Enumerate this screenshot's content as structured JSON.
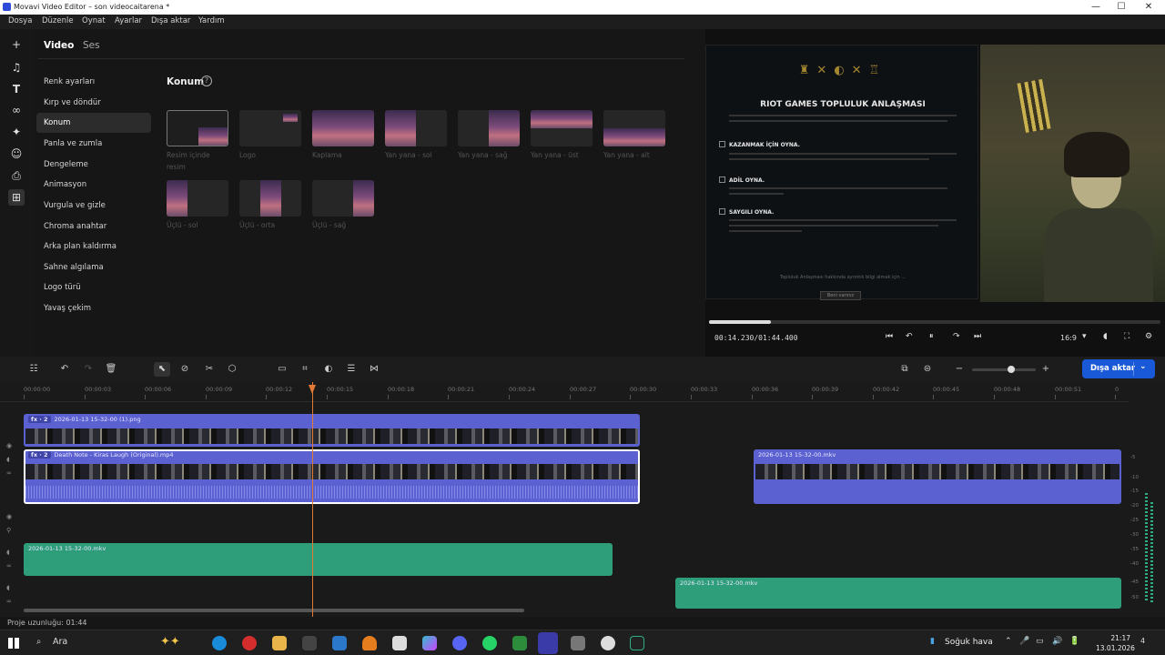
{
  "window": {
    "title": "Movavi Video Editor – son videocaitarena *",
    "controls": [
      "—",
      "☐",
      "✕"
    ]
  },
  "menu": [
    "Dosya",
    "Düzenle",
    "Oynat",
    "Ayarlar",
    "Dışa aktar",
    "Yardım"
  ],
  "sidebar_icons": [
    "plus-icon",
    "music-note-icon",
    "text-t-icon",
    "transition-icon",
    "sparkle-icon",
    "sticker-icon",
    "camera-icon",
    "tools-grid-icon"
  ],
  "panel": {
    "tabs": [
      "Video",
      "Ses"
    ],
    "menu_items": [
      "Renk ayarları",
      "Kırp ve döndür",
      "Konum",
      "Panla ve zumla",
      "Dengeleme",
      "Animasyon",
      "Vurgula ve gizle",
      "Chroma anahtar",
      "Arka plan kaldırma",
      "Sahne algılama",
      "Logo türü",
      "Yavaş çekim"
    ],
    "selected_item": "Konum",
    "section_title": "Konum",
    "tiles": [
      {
        "label": "Resim içinde resim"
      },
      {
        "label": "Logo"
      },
      {
        "label": "Kaplama"
      },
      {
        "label": "Yan yana - sol"
      },
      {
        "label": "Yan yana - sağ"
      },
      {
        "label": "Yan yana - üst"
      },
      {
        "label": "Yan yana - alt"
      },
      {
        "label": "Üçlü - sol"
      },
      {
        "label": "Üçlü - orta"
      },
      {
        "label": "Üçlü - sağ"
      }
    ]
  },
  "preview": {
    "game_overlay": {
      "heading": "RIOT GAMES TOPLULUK ANLAŞMASI",
      "rules": [
        "KAZANMAK İÇİN OYNA.",
        "ADİL OYNA.",
        "SAYGILI OYNA."
      ],
      "footer": "Topluluk Anlaşması hakkında ayrıntılı bilgi almak için ...",
      "button": "Beni varınız"
    },
    "timecode": "00:14.230/01:44.400",
    "progress_fraction": 0.1363,
    "aspect": "16:9",
    "controls": {
      "prev": "⏮",
      "back": "↶",
      "pause": "⏸",
      "fwd": "↷",
      "next": "⏭",
      "aspect_caret": "▾",
      "volume": "◖",
      "fullscreen": "⛶",
      "settings": "⚙"
    }
  },
  "toolbar": {
    "export_label": "Dışa aktar",
    "export_caret": "⌄",
    "icons": {
      "settings": "☷",
      "undo": "↶",
      "redo": "↷",
      "trash": "🗑",
      "select": "⬉",
      "razor_tool": "⊘",
      "scissors": "✂",
      "marker": "⬡",
      "caption": "▭",
      "crop": "⌗",
      "color": "◐",
      "adjust": "☰",
      "transition": "⋈",
      "detach": "⧉",
      "record": "⊜",
      "zoom_out": "−",
      "zoom_in": "+"
    },
    "zoom_level": 0.62
  },
  "ruler_ticks": [
    "00:00:00",
    "00:00:03",
    "00:00:06",
    "00:00:09",
    "00:00:12",
    "00:00:15",
    "00:00:18",
    "00:00:21",
    "00:00:24",
    "00:00:27",
    "00:00:30",
    "00:00:33",
    "00:00:36",
    "00:00:39",
    "00:00:42",
    "00:00:45",
    "00:00:48",
    "00:00:51",
    "0"
  ],
  "clips": {
    "overlay_image": {
      "fx": "fx · 2",
      "name": "2026-01-13 15-32-00 (1).png"
    },
    "main_video": {
      "fx": "fx · 2",
      "name": "Death Note - Kiras Laugh (Original).mp4"
    },
    "right_video": {
      "name": "2026-01-13 15-32-00.mkv"
    },
    "audio1": {
      "name": "2026-01-13 15-32-00.mkv"
    },
    "audio2": {
      "name": "2026-01-13 15-32-00.mkv"
    }
  },
  "meter_labels": [
    "-5",
    "-10",
    "-15",
    "-20",
    "-25",
    "-30",
    "-35",
    "-40",
    "-45",
    "-50"
  ],
  "status": "Proje uzunluğu: 01:44",
  "taskbar": {
    "search": "Ara",
    "weather": "Soğuk hava",
    "time": "21:17",
    "date": "13.01.2026",
    "tray": [
      "⌃",
      "🎤",
      "▭",
      "🔊",
      "🔋"
    ],
    "notify": "4"
  }
}
